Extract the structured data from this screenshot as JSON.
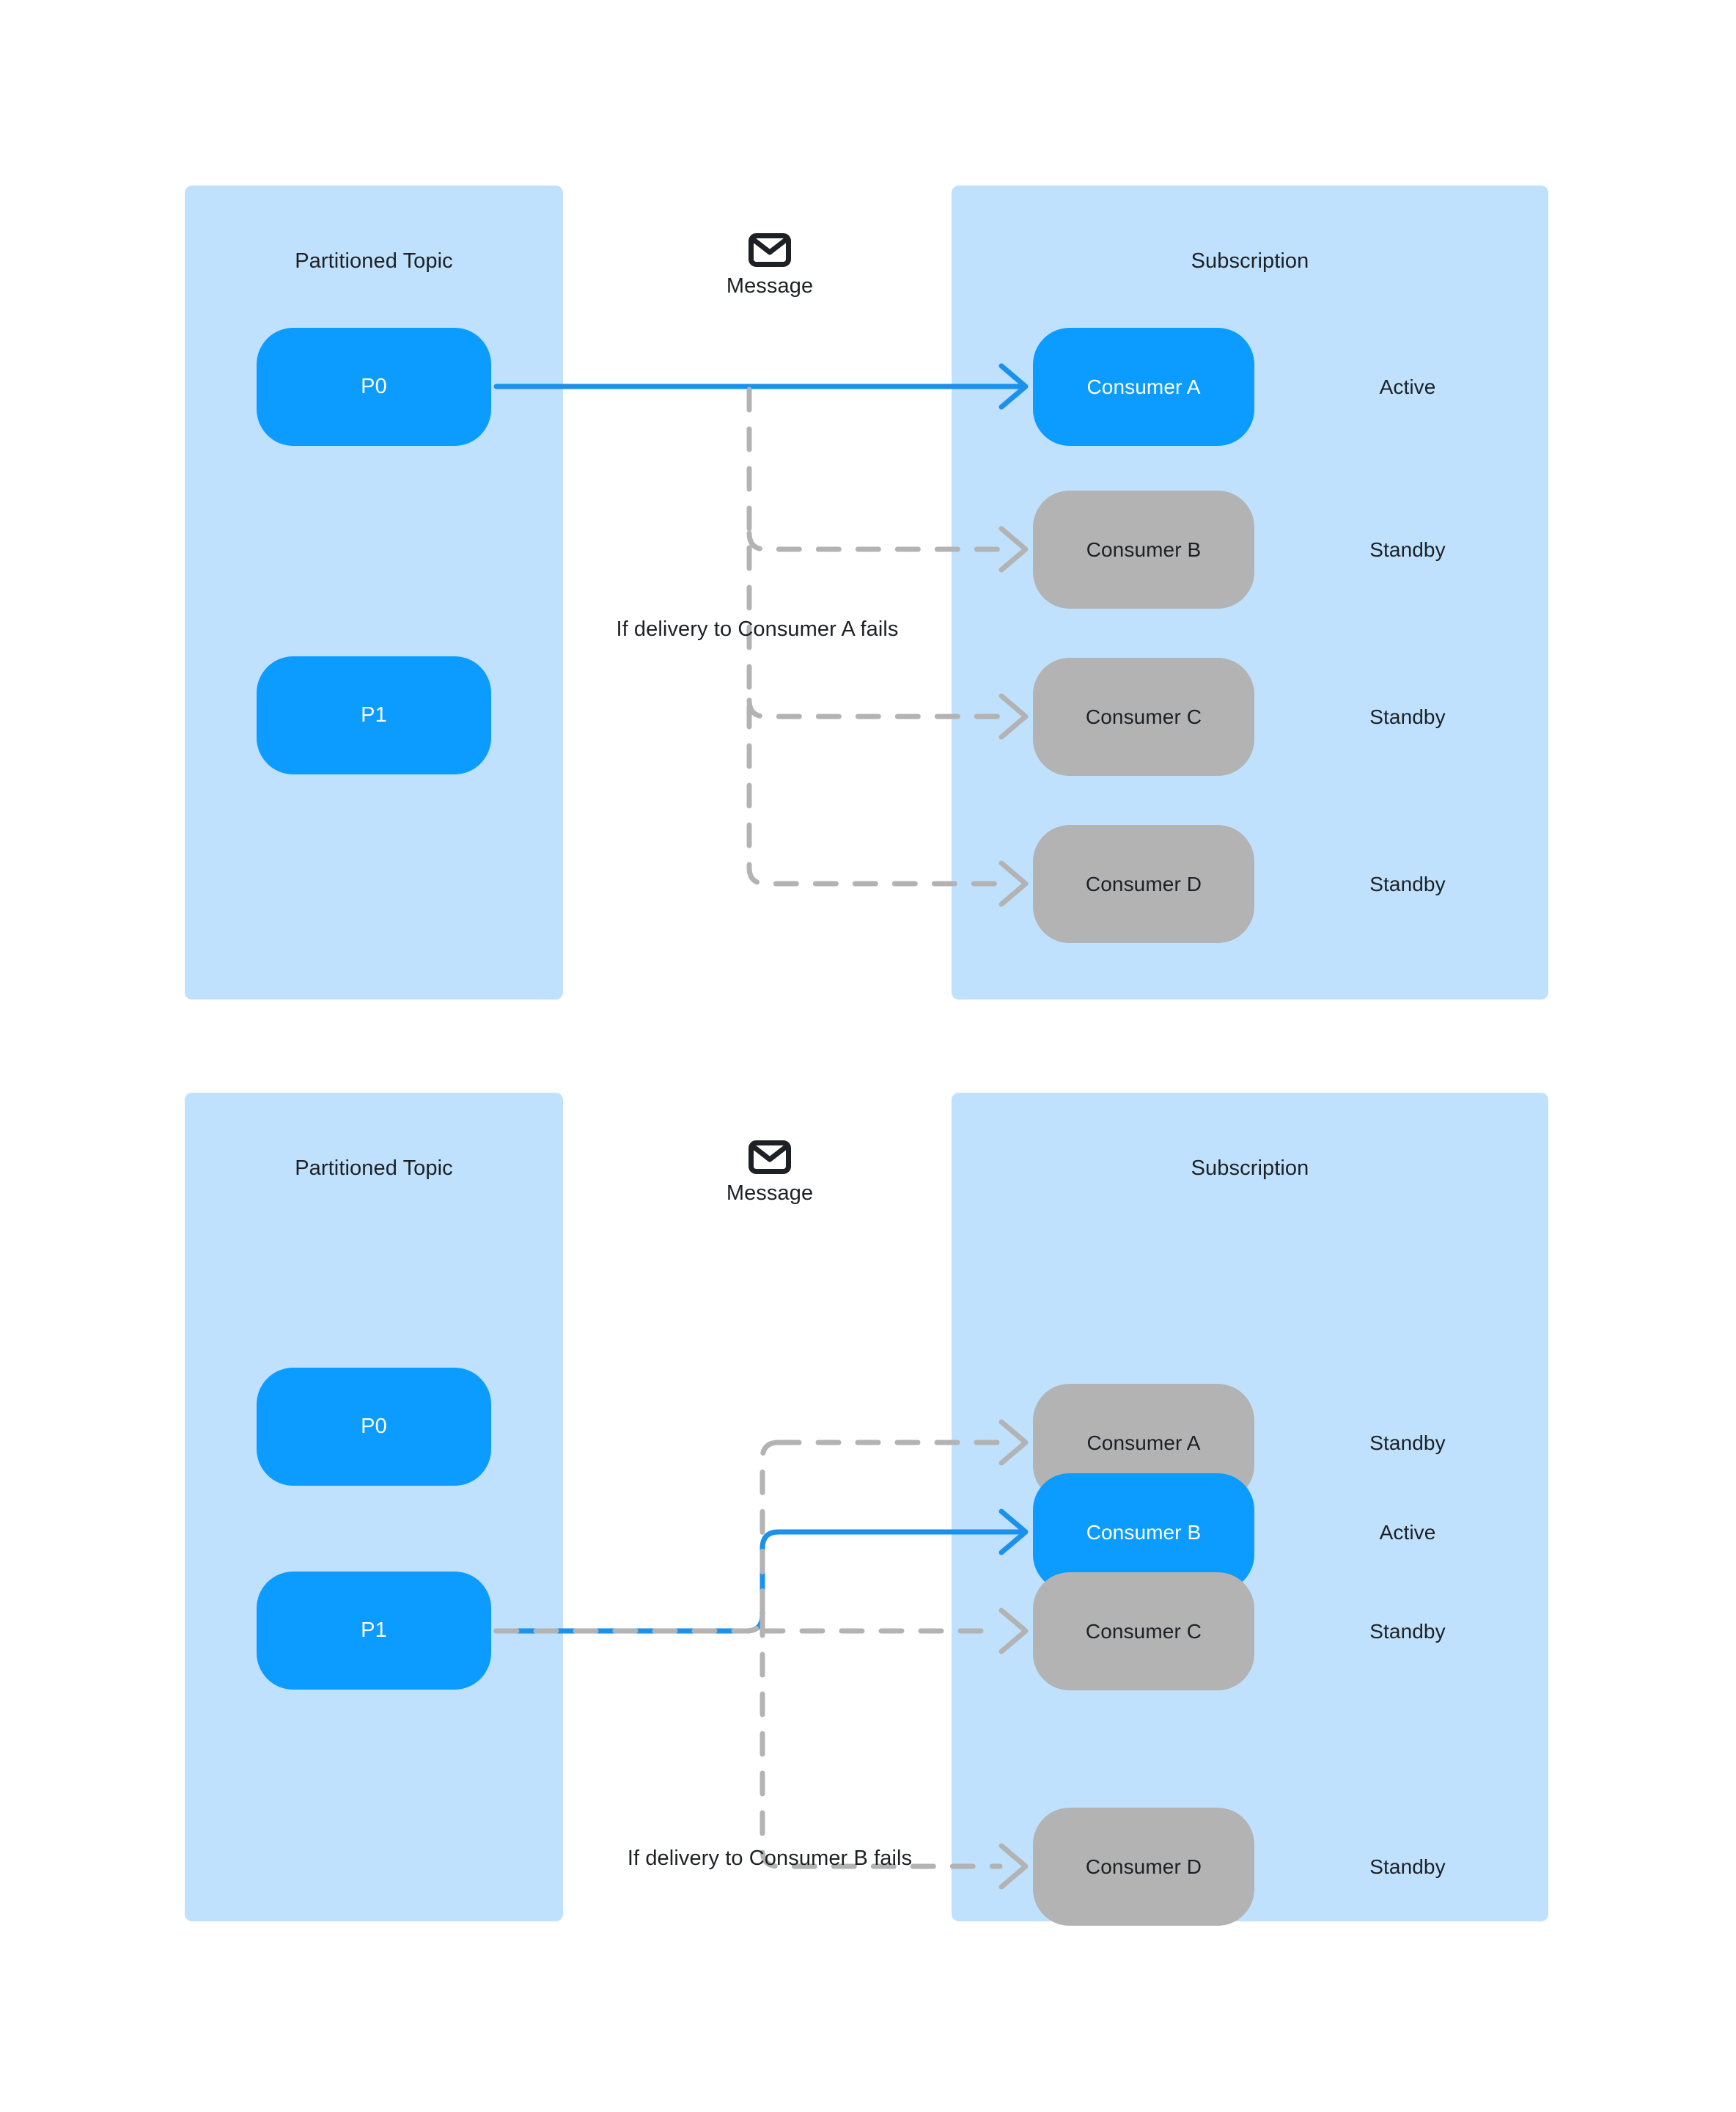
{
  "page": {
    "background": "#ffffff",
    "accent_blue": "#0c9bff",
    "line_blue": "#1a91ec",
    "panel_blue": "#bfe1fd",
    "standby_gray": "#b3b3b3",
    "text_color": "#1d2125"
  },
  "diagrams": [
    {
      "id": "scenario-a",
      "left_panel_title": "Partitioned Topic",
      "right_panel_title": "Subscription",
      "message_icon": "envelope-icon",
      "message_label": "Message",
      "fail_caption": "If delivery to Consumer A fails",
      "partitions": [
        {
          "label": "P0",
          "state": "active"
        },
        {
          "label": "P1",
          "state": "active"
        }
      ],
      "consumers": [
        {
          "label": "Consumer A",
          "status": "Active",
          "state": "active"
        },
        {
          "label": "Consumer B",
          "status": "Standby",
          "state": "standby"
        },
        {
          "label": "Consumer C",
          "status": "Standby",
          "state": "standby"
        },
        {
          "label": "Consumer D",
          "status": "Standby",
          "state": "standby"
        }
      ],
      "active_delivery": {
        "from": "P0",
        "to": "Consumer A"
      },
      "failover_targets": [
        "Consumer B",
        "Consumer C",
        "Consumer D"
      ]
    },
    {
      "id": "scenario-b",
      "left_panel_title": "Partitioned Topic",
      "right_panel_title": "Subscription",
      "message_icon": "envelope-icon",
      "message_label": "Message",
      "fail_caption": "If delivery to Consumer B fails",
      "partitions": [
        {
          "label": "P0",
          "state": "active"
        },
        {
          "label": "P1",
          "state": "active"
        }
      ],
      "consumers": [
        {
          "label": "Consumer A",
          "status": "Standby",
          "state": "standby"
        },
        {
          "label": "Consumer B",
          "status": "Active",
          "state": "active"
        },
        {
          "label": "Consumer C",
          "status": "Standby",
          "state": "standby"
        },
        {
          "label": "Consumer D",
          "status": "Standby",
          "state": "standby"
        }
      ],
      "active_delivery": {
        "from": "P1",
        "to": "Consumer B"
      },
      "failover_targets": [
        "Consumer A",
        "Consumer C",
        "Consumer D"
      ]
    }
  ]
}
